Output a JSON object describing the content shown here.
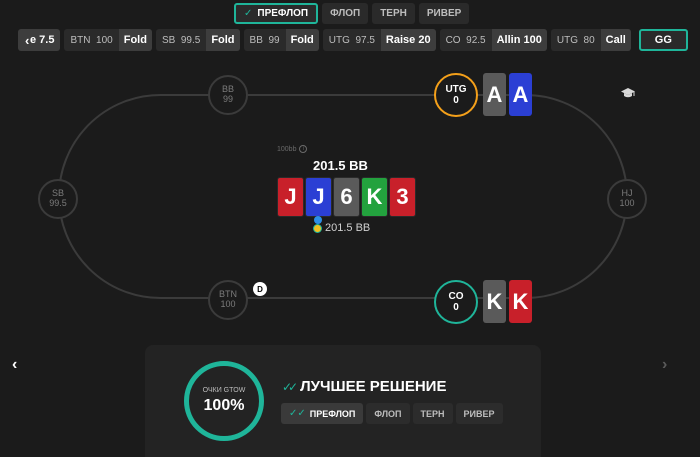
{
  "street_tabs": [
    {
      "label": "ПРЕФЛОП",
      "active": true
    },
    {
      "label": "ФЛОП",
      "active": false
    },
    {
      "label": "ТЕРН",
      "active": false
    },
    {
      "label": "РИВЕР",
      "active": false
    }
  ],
  "action_bar": {
    "first": {
      "amount": "e 7.5"
    },
    "items": [
      {
        "pos": "BTN",
        "stack": "100",
        "action": "Fold"
      },
      {
        "pos": "SB",
        "stack": "99.5",
        "action": "Fold"
      },
      {
        "pos": "BB",
        "stack": "99",
        "action": "Fold"
      },
      {
        "pos": "UTG",
        "stack": "97.5",
        "action": "Raise 20"
      },
      {
        "pos": "CO",
        "stack": "92.5",
        "action": "Allin 100"
      },
      {
        "pos": "UTG",
        "stack": "80",
        "action": "Call"
      }
    ],
    "result": "GG"
  },
  "seats": {
    "bb": {
      "pos": "BB",
      "stack": "99"
    },
    "sb": {
      "pos": "SB",
      "stack": "99.5"
    },
    "hj": {
      "pos": "HJ",
      "stack": "100"
    },
    "btn": {
      "pos": "BTN",
      "stack": "100"
    },
    "utg": {
      "pos": "UTG",
      "stack": "0"
    },
    "co": {
      "pos": "CO",
      "stack": "0"
    }
  },
  "dealer": "D",
  "utg_cards": [
    {
      "rank": "A",
      "color": "grey"
    },
    {
      "rank": "A",
      "color": "blue"
    }
  ],
  "co_cards": [
    {
      "rank": "K",
      "color": "grey"
    },
    {
      "rank": "K",
      "color": "red"
    }
  ],
  "pot": {
    "stack_label": "100bb",
    "total": "201.5 BB",
    "chips": "201.5 BB"
  },
  "board": [
    {
      "rank": "J",
      "color": "red"
    },
    {
      "rank": "J",
      "color": "blue"
    },
    {
      "rank": "6",
      "color": "grey"
    },
    {
      "rank": "K",
      "color": "green"
    },
    {
      "rank": "3",
      "color": "red"
    }
  ],
  "score": {
    "label": "ОЧКИ GTOW",
    "value": "100%"
  },
  "best_decision": "ЛУЧШЕЕ РЕШЕНИЕ",
  "mini_tabs": [
    {
      "label": "ПРЕФЛОП",
      "active": true
    },
    {
      "label": "ФЛОП",
      "active": false
    },
    {
      "label": "ТЕРН",
      "active": false
    },
    {
      "label": "РИВЕР",
      "active": false
    }
  ],
  "colors": {
    "accent": "#1fb59a",
    "utg_ring": "#f4a01a",
    "card_red": "#c8202a",
    "card_blue": "#2b3fd4",
    "card_green": "#23a23e",
    "card_grey": "#5a5a5a"
  },
  "icons": {
    "back": "chevron-left-icon",
    "study": "graduation-cap-icon",
    "info": "info-icon"
  }
}
